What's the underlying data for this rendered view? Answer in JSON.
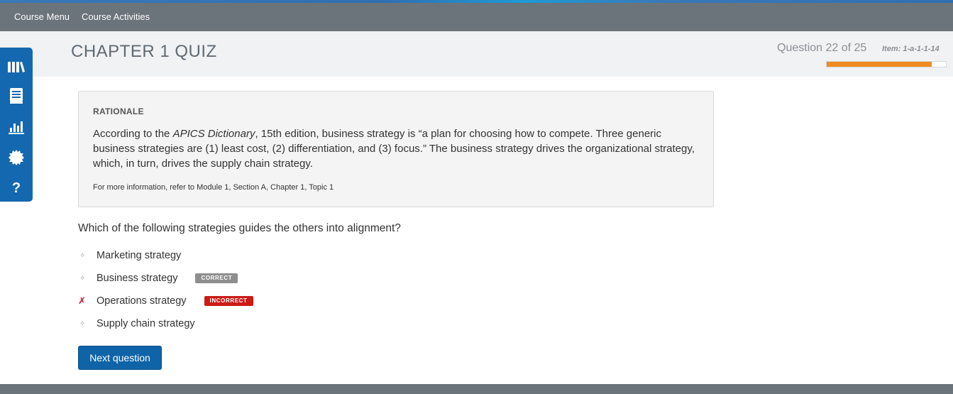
{
  "nav": {
    "course_menu": "Course Menu",
    "course_activities": "Course Activities"
  },
  "header": {
    "title": "CHAPTER 1 QUIZ",
    "question_counter": "Question 22 of 25",
    "item_id": "Item: 1-a-1-1-14",
    "progress_fraction": 0.88
  },
  "sidebar": {
    "icons": [
      "library-icon",
      "book-icon",
      "bar-chart-icon",
      "settings-gear-icon",
      "help-icon"
    ]
  },
  "rationale": {
    "heading": "RATIONALE",
    "body_before": "According to the ",
    "body_italic": "APICS Dictionary",
    "body_after": ", 15th edition, business strategy is “a plan for choosing how to compete. Three generic business strategies are (1) least cost, (2) differentiation, and (3) focus.” The business strategy drives the organizational strategy, which, in turn, drives the supply chain strategy.",
    "reference": "For more information, refer to Module 1, Section A, Chapter 1, Topic 1"
  },
  "question": {
    "text": "Which of the following strategies guides the others into alignment?",
    "options": [
      {
        "label": "Marketing strategy",
        "marker": "✧",
        "badge": ""
      },
      {
        "label": "Business strategy",
        "marker": "✧",
        "badge": "CORRECT"
      },
      {
        "label": "Operations strategy",
        "marker": "✗",
        "badge": "INCORRECT"
      },
      {
        "label": "Supply chain strategy",
        "marker": "✧",
        "badge": ""
      }
    ]
  },
  "actions": {
    "next_label": "Next question"
  },
  "colors": {
    "nav_bg": "#6b737b",
    "sidebar_bg": "#1468b0",
    "progress": "#ef8b22",
    "correct_badge": "#8e8e8e",
    "incorrect_badge": "#cc1b17",
    "button": "#0f64a8"
  }
}
